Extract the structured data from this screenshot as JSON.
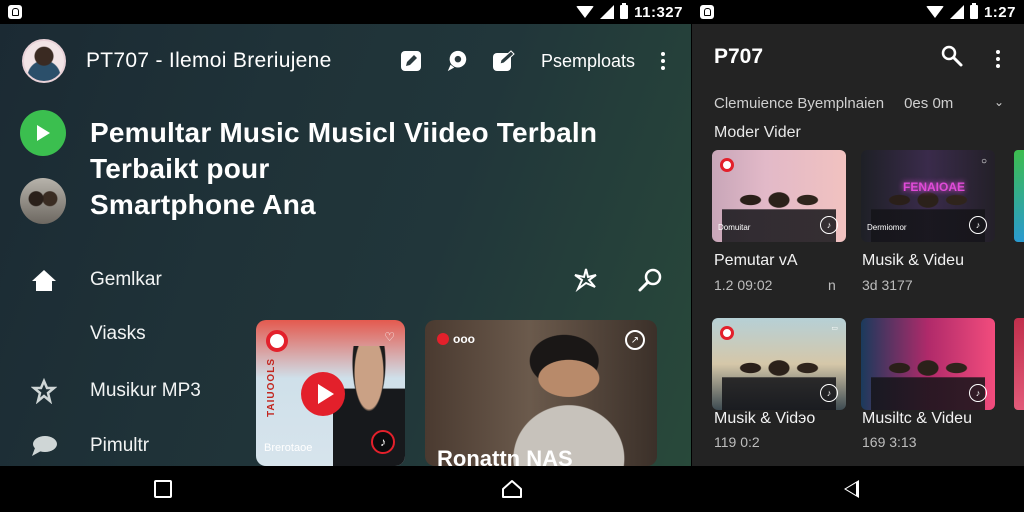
{
  "left": {
    "status_time": "11:327",
    "top_title": "PT707 - Ilemoi Breriujene",
    "top_link": "Psemploats",
    "headline_line1": "Pemultar Music Musicl Viideo Terbaln",
    "headline_line2": "Terbaikt pour",
    "headline_line3": "Smartphone Ana",
    "nav": [
      {
        "label": "Gemlkar",
        "icon": "home-icon"
      },
      {
        "label": "Viasks",
        "icon": ""
      },
      {
        "label": "Musikur MP3",
        "icon": "music-star-icon"
      },
      {
        "label": "Pimultr",
        "icon": "chat-icon"
      }
    ],
    "card1": {
      "vertical_text": "TAIUOOLS",
      "caption": "Brerotaoe"
    },
    "card2": {
      "brand": "ooo",
      "title": "Ronattn NAS"
    }
  },
  "right": {
    "status_time": "1:27",
    "title": "P707",
    "subtitle": "Clemuience Byemplnaien",
    "subtitle_time": "0es 0m",
    "section": "Moder Vider",
    "thumbs": [
      {
        "title": "Pemutar vA",
        "meta": "1.2 09:02",
        "meta2": "n",
        "caption": "Domuitar",
        "neon": ""
      },
      {
        "title": "Musik & Videu",
        "meta": "3d 3177",
        "meta2": "",
        "caption": "Dermiomor",
        "neon": "FENAIOAE"
      },
      {
        "title": "Musik & Vidэo",
        "meta": "119 0:2",
        "meta2": "",
        "caption": "",
        "neon": ""
      },
      {
        "title": "Musiltc & Videu",
        "meta": "169 3:13",
        "meta2": "",
        "caption": "",
        "neon": ""
      }
    ]
  },
  "colors": {
    "accent_green": "#3bbf4f",
    "accent_red": "#e3202b",
    "right_bg": "#232323"
  }
}
